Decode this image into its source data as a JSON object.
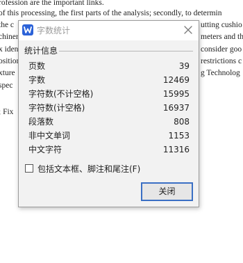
{
  "document": {
    "lines": [
      "rofession are the important links.",
      " of this processing, the first parts of the analysis; secondly, to determin",
      "the c",
      "utting cushio",
      "chiner",
      "meters and th",
      "x iden",
      "consider goo",
      "osition",
      "restrictions c",
      "xture",
      "g Technolog",
      " spec",
      ";  Fix"
    ]
  },
  "dialog": {
    "title": "字数统计",
    "group_label": "统计信息",
    "stats": [
      {
        "label": "页数",
        "value": "39"
      },
      {
        "label": "字数",
        "value": "12469"
      },
      {
        "label": "字符数(不计空格)",
        "value": "15995"
      },
      {
        "label": "字符数(计空格)",
        "value": "16937"
      },
      {
        "label": "段落数",
        "value": "808"
      },
      {
        "label": "非中文单词",
        "value": "1153"
      },
      {
        "label": "中文字符",
        "value": "11316"
      }
    ],
    "include_textboxes_label": "包括文本框、脚注和尾注(F)",
    "include_textboxes_checked": false,
    "close_button_label": "关闭"
  },
  "colors": {
    "accent": "#3a6fc4",
    "app_icon": "#2b62d8",
    "dialog_bg": "#f2f2f2"
  },
  "icons": {
    "app": "wps-writer-icon",
    "close": "close-icon"
  }
}
